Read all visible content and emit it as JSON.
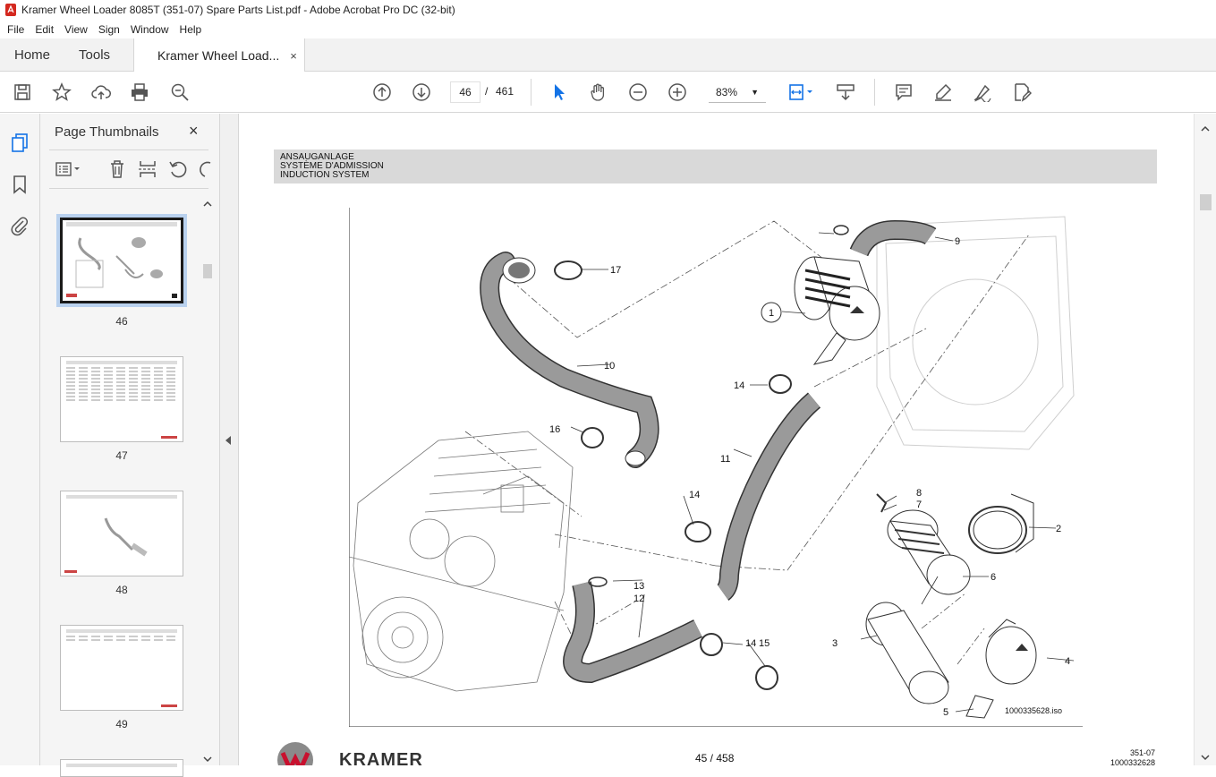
{
  "window": {
    "title": "Kramer Wheel Loader 8085T (351-07) Spare Parts List.pdf - Adobe Acrobat Pro DC (32-bit)"
  },
  "menu": [
    "File",
    "Edit",
    "View",
    "Sign",
    "Window",
    "Help"
  ],
  "tabs": {
    "home": "Home",
    "tools": "Tools",
    "document": "Kramer Wheel Load...",
    "close": "×"
  },
  "toolbar": {
    "page_current": "46",
    "page_sep": "/",
    "page_total": "461",
    "zoom": "83%"
  },
  "thumbnail_panel": {
    "title": "Page Thumbnails",
    "close": "×",
    "pages": [
      {
        "number": "46",
        "selected": true
      },
      {
        "number": "47",
        "selected": false
      },
      {
        "number": "48",
        "selected": false
      },
      {
        "number": "49",
        "selected": false
      }
    ]
  },
  "document": {
    "header": [
      "ANSAUGANLAGE",
      "SYSTÈME D'ADMISSION",
      "INDUCTION SYSTEM"
    ],
    "callouts": [
      "17",
      "9",
      "1",
      "10",
      "14",
      "16",
      "11",
      "14",
      "8",
      "7",
      "2",
      "6",
      "13",
      "12",
      "14",
      "15",
      "3",
      "4",
      "5"
    ],
    "image_ref": "1000335628.iso",
    "footer": {
      "brand": "KRAMER",
      "page": "45 / 458",
      "code1": "351-07",
      "code2": "1000332628"
    }
  },
  "colors": {
    "accent": "#1473e6",
    "pointer_blue": "#1473e6",
    "header_gray": "#d9d9d9",
    "part_fill": "#9a9a9a"
  }
}
